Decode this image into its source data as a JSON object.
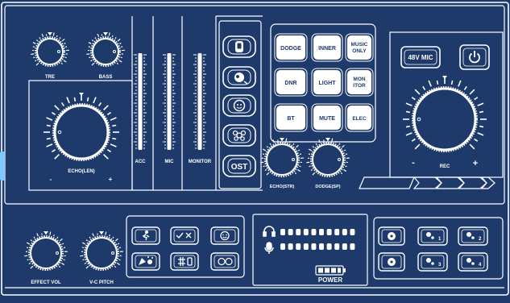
{
  "colors": {
    "background": "#1d3a6b",
    "line": "#ffffff",
    "button_fill": "#ffffff",
    "button_text": "#1d3a6b"
  },
  "knobs": {
    "treble": {
      "label": "TRE"
    },
    "bass": {
      "label": "BASS"
    },
    "echo_len": {
      "label": "ECHO(LEN)",
      "minus": "-",
      "plus": "+"
    },
    "echo_str": {
      "label": "ECHO(STR)"
    },
    "dodge_sp": {
      "label": "DODGE(SP)"
    },
    "rec": {
      "label": "REC",
      "minus": "-",
      "plus": "+"
    },
    "effect_vol": {
      "label": "EFFECT VOL"
    },
    "vc_pitch": {
      "label": "V-C PITCH"
    }
  },
  "faders": {
    "acc": "ACC",
    "mic": "MIC",
    "monitor": "MONITOR"
  },
  "side_buttons": {
    "items": [
      {
        "icon": "phone-icon"
      },
      {
        "icon": "voice-icon"
      },
      {
        "icon": "face-icon"
      },
      {
        "icon": "flower-icon"
      },
      {
        "icon": "ost-label",
        "label": "OST"
      }
    ]
  },
  "function_buttons": {
    "dodge": "DODGE",
    "inner": "INNER",
    "music_only_1": "MUSIC",
    "music_only_2": "ONLY",
    "dnr": "DNR",
    "light": "LIGHT",
    "monitor_1": "MON",
    "monitor_2": "ITOR",
    "bt": "BT",
    "mute": "MUTE",
    "elec": "ELEC"
  },
  "top_right": {
    "mic48v": "48V MIC",
    "power_icon": "power-icon"
  },
  "meters": {
    "headphone_icon": "headphone-icon",
    "mic_icon": "mic-icon",
    "battery_icon": "battery-icon",
    "power_label": "POWER"
  },
  "effect_pads": [
    {
      "icon": "run-icon"
    },
    {
      "icon": "check-cross-icon"
    },
    {
      "icon": "smile-icon"
    },
    {
      "icon": "party-icon"
    },
    {
      "icon": "hash-icon"
    },
    {
      "icon": "duo-face-icon"
    }
  ],
  "preset_pads": [
    {
      "icon": "disc-icon"
    },
    {
      "icon": "gear-1-icon",
      "number": "1"
    },
    {
      "icon": "gear-2-icon",
      "number": "2"
    },
    {
      "icon": "disc-icon"
    },
    {
      "icon": "gear-3-icon",
      "number": "3"
    },
    {
      "icon": "gear-4-icon",
      "number": "4"
    }
  ]
}
